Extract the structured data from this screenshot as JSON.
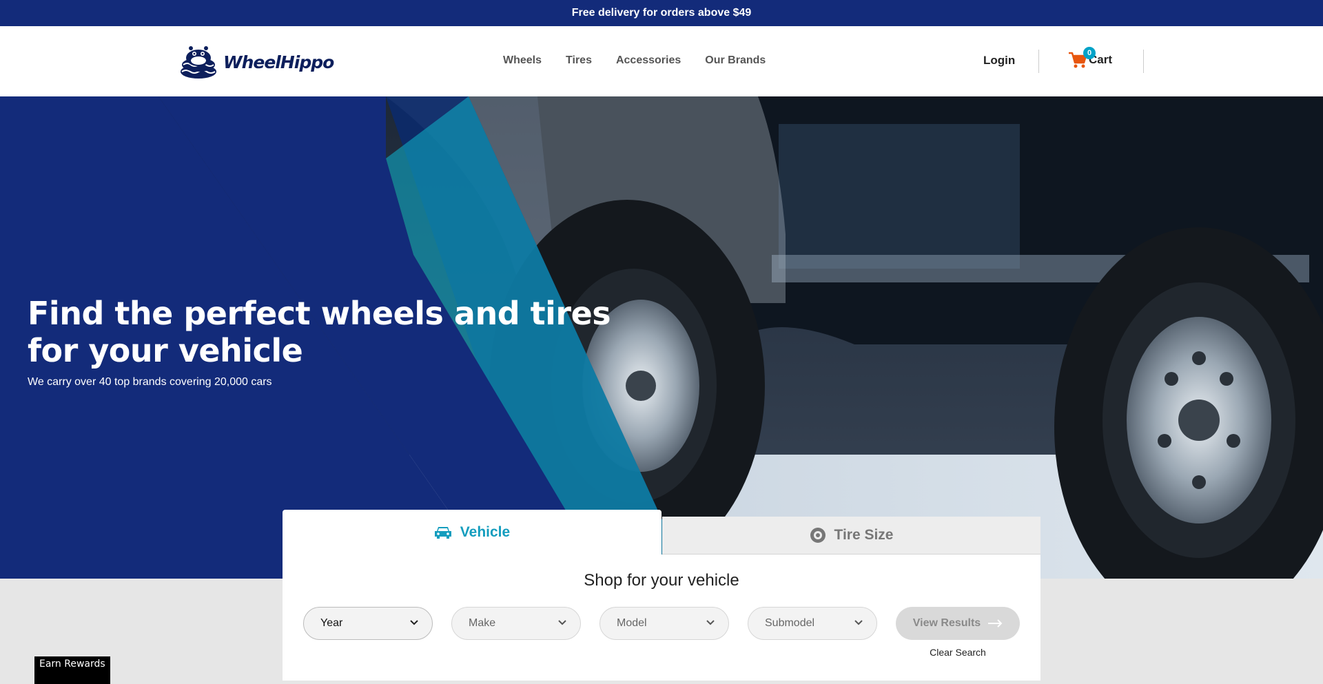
{
  "promo": {
    "text": "Free delivery for orders above $49"
  },
  "header": {
    "logo_text": "WheelHippo",
    "nav": [
      {
        "label": "Wheels"
      },
      {
        "label": "Tires"
      },
      {
        "label": "Accessories"
      },
      {
        "label": "Our Brands"
      }
    ],
    "login_label": "Login",
    "cart_label": "Cart",
    "cart_count": "0"
  },
  "hero": {
    "title": "Find the perfect wheels and tires for your vehicle",
    "subtitle": "We carry over 40 top brands covering 20,000 cars"
  },
  "search": {
    "tabs": [
      {
        "label": "Vehicle",
        "icon": "car-icon",
        "active": true
      },
      {
        "label": "Tire Size",
        "icon": "tire-icon",
        "active": false
      }
    ],
    "title": "Shop for your vehicle",
    "selects": [
      {
        "label": "Year"
      },
      {
        "label": "Make"
      },
      {
        "label": "Model"
      },
      {
        "label": "Submodel"
      }
    ],
    "view_results_label": "View Results",
    "clear_label": "Clear Search"
  },
  "rewards": {
    "label": "Earn Rewards"
  },
  "colors": {
    "brand_navy": "#132b7a",
    "accent_teal": "#149dbe",
    "cart_orange": "#e8560f"
  }
}
